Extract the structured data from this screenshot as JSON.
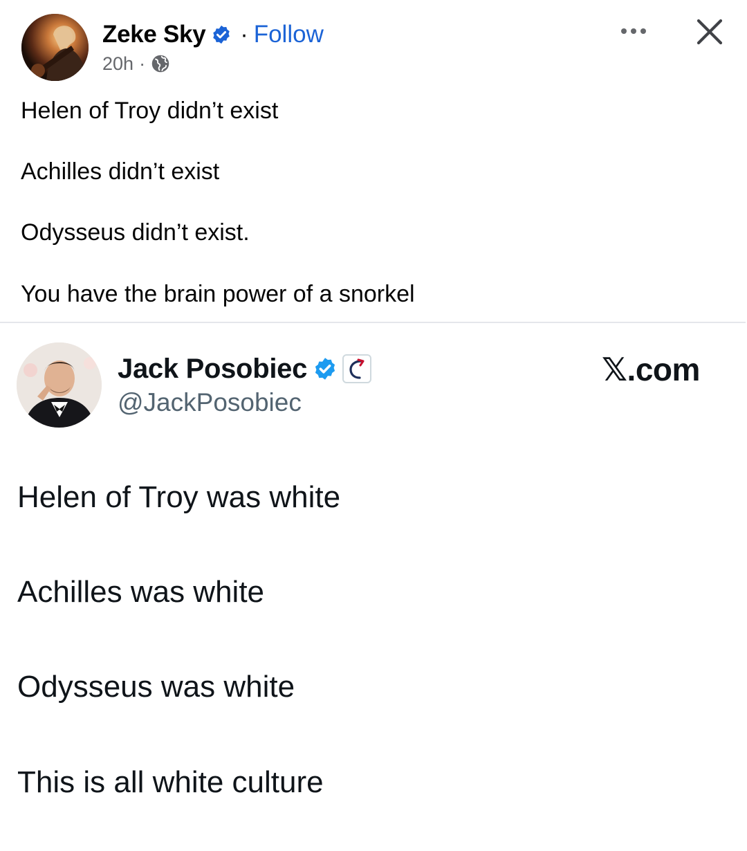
{
  "post": {
    "author": {
      "name": "Zeke Sky",
      "verified": true,
      "separator": "·",
      "follow_label": "Follow"
    },
    "meta": {
      "time": "20h",
      "separator": "·",
      "audience_icon": "globe-icon"
    },
    "actions": {
      "more_icon": "more-options-icon",
      "close_icon": "close-icon"
    },
    "lines": [
      "Helen of Troy didn’t exist",
      "Achilles didn’t exist",
      "Odysseus didn’t exist.",
      "You have the brain power of a snorkel"
    ]
  },
  "embed": {
    "author": {
      "name": "Jack Posobiec",
      "handle": "@JackPosobiec",
      "verified": true,
      "affiliate_badge": "affiliate-badge-icon"
    },
    "source": "𝕏.com",
    "lines": [
      "Helen of Troy was white",
      "Achilles was white",
      "Odysseus was white",
      "This is all white culture"
    ]
  },
  "colors": {
    "follow_blue": "#1b63d6",
    "verified_blue": "#1d9bf0",
    "meta_gray": "#65676b",
    "handle_gray": "#536471",
    "affiliate_red": "#c8102e"
  }
}
